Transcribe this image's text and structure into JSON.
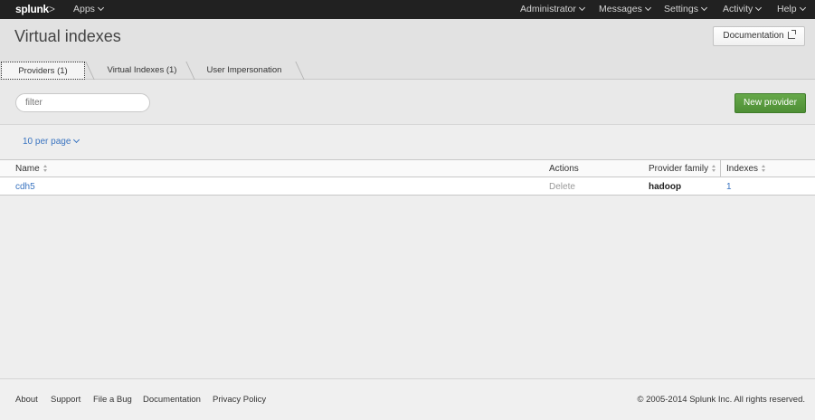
{
  "topbar": {
    "logo": "splunk",
    "logo_suffix": ">",
    "apps": "Apps",
    "nav": [
      "Administrator",
      "Messages",
      "Settings",
      "Activity",
      "Help"
    ]
  },
  "header": {
    "title": "Virtual indexes",
    "doc_button": "Documentation"
  },
  "tabs": [
    "Providers (1)",
    "Virtual Indexes (1)",
    "User Impersonation"
  ],
  "filter": {
    "placeholder": "filter"
  },
  "new_provider_button": "New provider",
  "paging": {
    "per_page": "10 per page"
  },
  "table": {
    "columns": [
      "Name",
      "Actions",
      "Provider family",
      "Indexes"
    ],
    "rows": [
      {
        "name": "cdh5",
        "action": "Delete",
        "family": "hadoop",
        "indexes": "1"
      }
    ]
  },
  "footer": {
    "links": [
      "About",
      "Support",
      "File a Bug",
      "Documentation",
      "Privacy Policy"
    ],
    "copyright": "© 2005-2014 Splunk Inc. All rights reserved."
  }
}
